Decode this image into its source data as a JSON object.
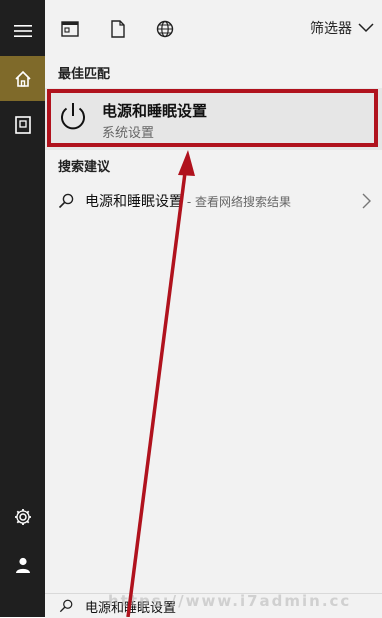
{
  "topbar": {
    "filter_label": "筛选器",
    "icons": [
      "app-icon",
      "document-icon",
      "globe-icon",
      "chevron-down-icon"
    ]
  },
  "rail": {
    "icons": [
      "hamburger-menu-icon",
      "home-icon",
      "notebook-icon",
      "gear-icon",
      "user-icon"
    ],
    "active": "home-icon"
  },
  "best_match": {
    "section_label": "最佳匹配",
    "title": "电源和睡眠设置",
    "subtitle": "系统设置",
    "icon": "power-icon",
    "highlight_color": "#b0121d"
  },
  "search_suggestions": {
    "section_label": "搜索建议",
    "items": [
      {
        "text": "电源和睡眠设置",
        "sub": " - 查看网络搜索结果"
      }
    ]
  },
  "search_box": {
    "value": "电源和睡眠设置"
  },
  "watermark": "https://www.i7admin.cc",
  "colors": {
    "accent": "#7f6a2a",
    "rail_bg": "#1f1f1f",
    "panel_bg": "#f2f2f2",
    "annotation_red": "#b0121d"
  }
}
